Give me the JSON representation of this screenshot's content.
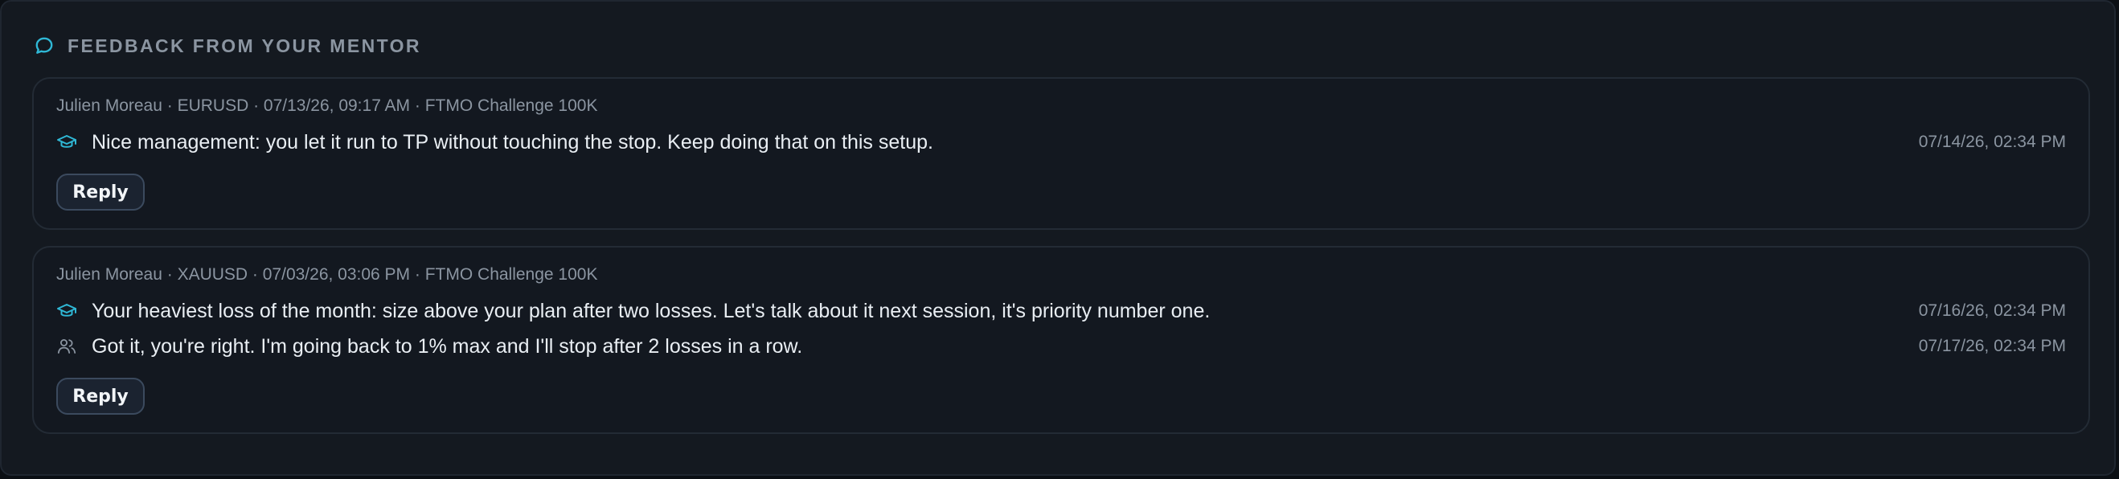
{
  "header": {
    "title": "FEEDBACK FROM YOUR MENTOR",
    "icon": "chat-bubble-icon",
    "accent_color": "#2fb8d6"
  },
  "threads": [
    {
      "meta": "Julien Moreau · EURUSD · 07/13/26, 09:17 AM · FTMO Challenge 100K",
      "messages": [
        {
          "author_icon": "mentor-graduation-cap-icon",
          "text": "Nice management: you let it run to TP without touching the stop. Keep doing that on this setup.",
          "time": "07/14/26, 02:34 PM"
        }
      ],
      "reply_label": "Reply"
    },
    {
      "meta": "Julien Moreau · XAUUSD · 07/03/26, 03:06 PM · FTMO Challenge 100K",
      "messages": [
        {
          "author_icon": "mentor-graduation-cap-icon",
          "text": "Your heaviest loss of the month: size above your plan after two losses. Let's talk about it next session, it's priority number one.",
          "time": "07/16/26, 02:34 PM"
        },
        {
          "author_icon": "student-users-icon",
          "text": "Got it, you're right. I'm going back to 1% max and I'll stop after 2 losses in a row.",
          "time": "07/17/26, 02:34 PM"
        }
      ],
      "reply_label": "Reply"
    }
  ]
}
